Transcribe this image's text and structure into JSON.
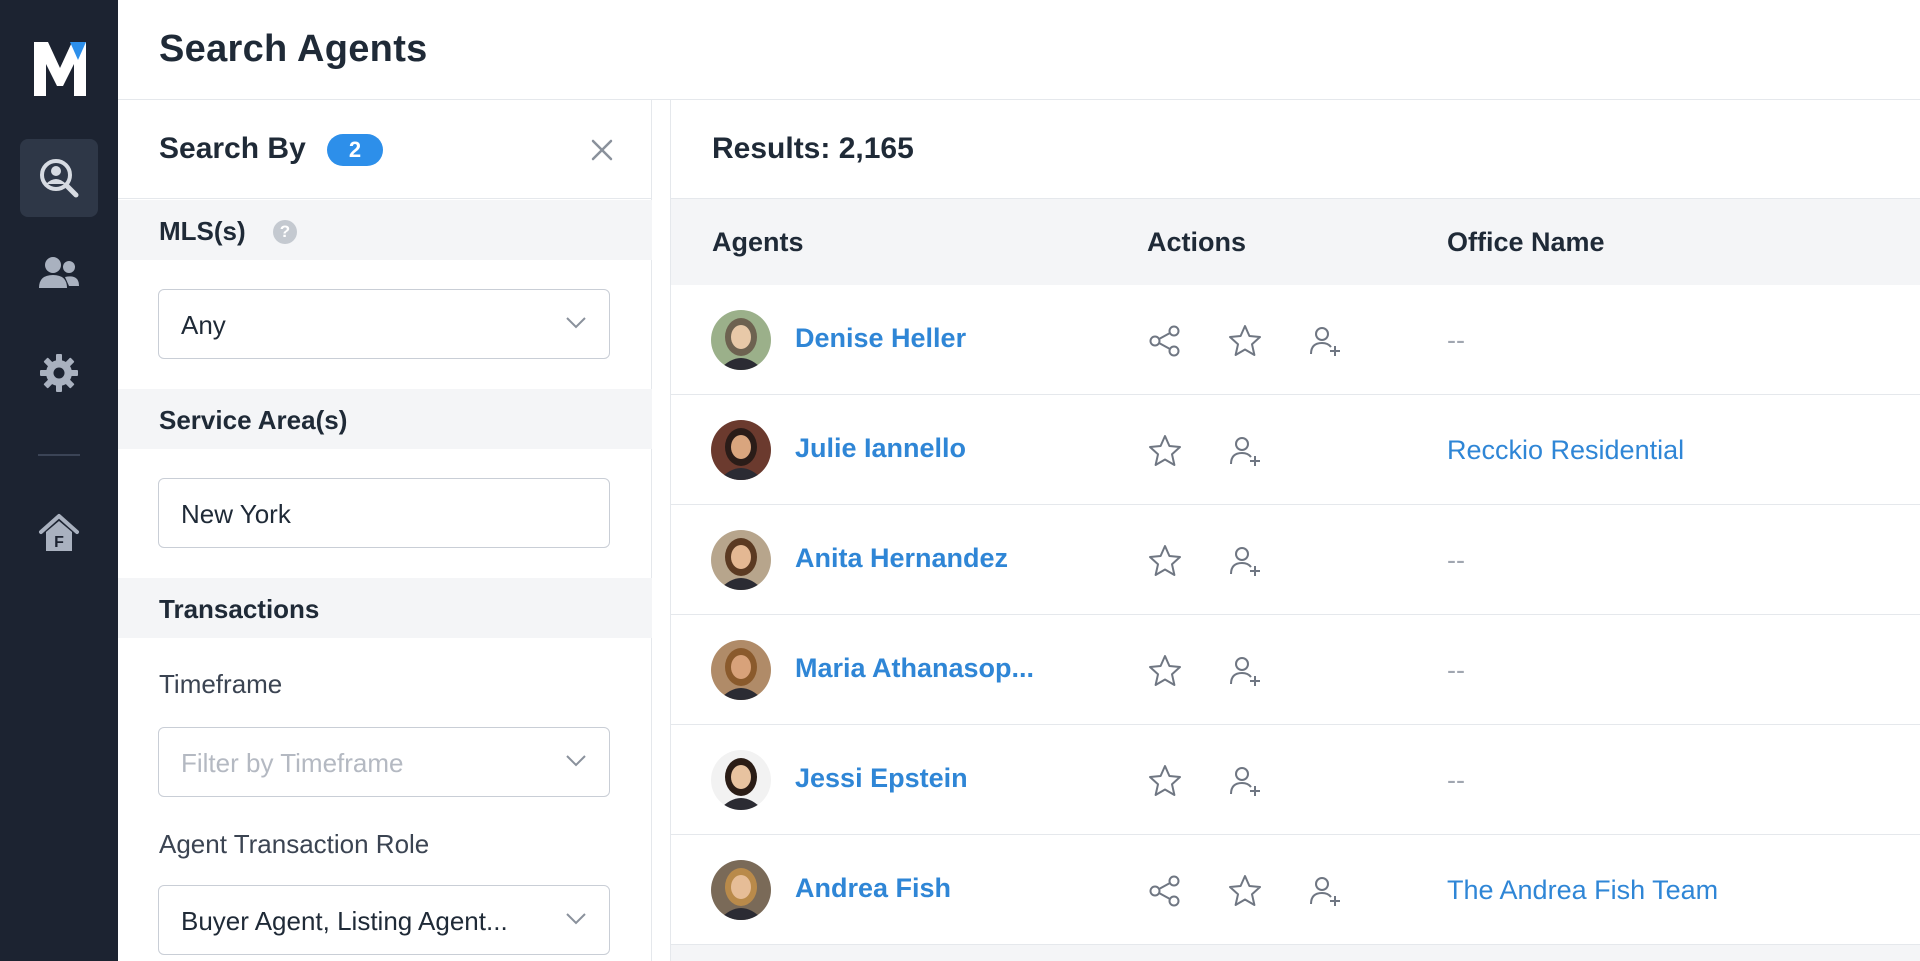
{
  "app": {
    "page_title": "Search Agents",
    "logo_icon": "m-logo-icon"
  },
  "nav": {
    "items": [
      {
        "icon": "search-user-icon",
        "active": true
      },
      {
        "icon": "users-icon",
        "active": false
      },
      {
        "icon": "gear-icon",
        "active": false
      },
      {
        "icon": "home-f-icon",
        "active": false
      }
    ]
  },
  "filters": {
    "title": "Search By",
    "count": "2",
    "mls_label": "MLS(s)",
    "mls_help": "?",
    "mls_value": "Any",
    "service_area_label": "Service Area(s)",
    "service_area_value": "New York",
    "transactions_label": "Transactions",
    "timeframe_label": "Timeframe",
    "timeframe_placeholder": "Filter by Timeframe",
    "role_label": "Agent Transaction Role",
    "role_value": "Buyer Agent, Listing Agent..."
  },
  "results": {
    "count_text": "Results: 2,165",
    "columns": {
      "agents": "Agents",
      "actions": "Actions",
      "office": "Office Name"
    },
    "rows": [
      {
        "name": "Denise Heller",
        "office": "--",
        "office_link": false,
        "share": true
      },
      {
        "name": "Julie Iannello",
        "office": "Recckio Residential",
        "office_link": true,
        "share": false
      },
      {
        "name": "Anita Hernandez",
        "office": "--",
        "office_link": false,
        "share": false
      },
      {
        "name": "Maria Athanasop...",
        "office": "--",
        "office_link": false,
        "share": false
      },
      {
        "name": "Jessi Epstein",
        "office": "--",
        "office_link": false,
        "share": false
      },
      {
        "name": "Andrea Fish",
        "office": "The Andrea Fish Team",
        "office_link": true,
        "share": true
      }
    ]
  },
  "colors": {
    "nav_bg": "#1c2331",
    "accent": "#2d8fea",
    "link": "#2f86d6"
  }
}
